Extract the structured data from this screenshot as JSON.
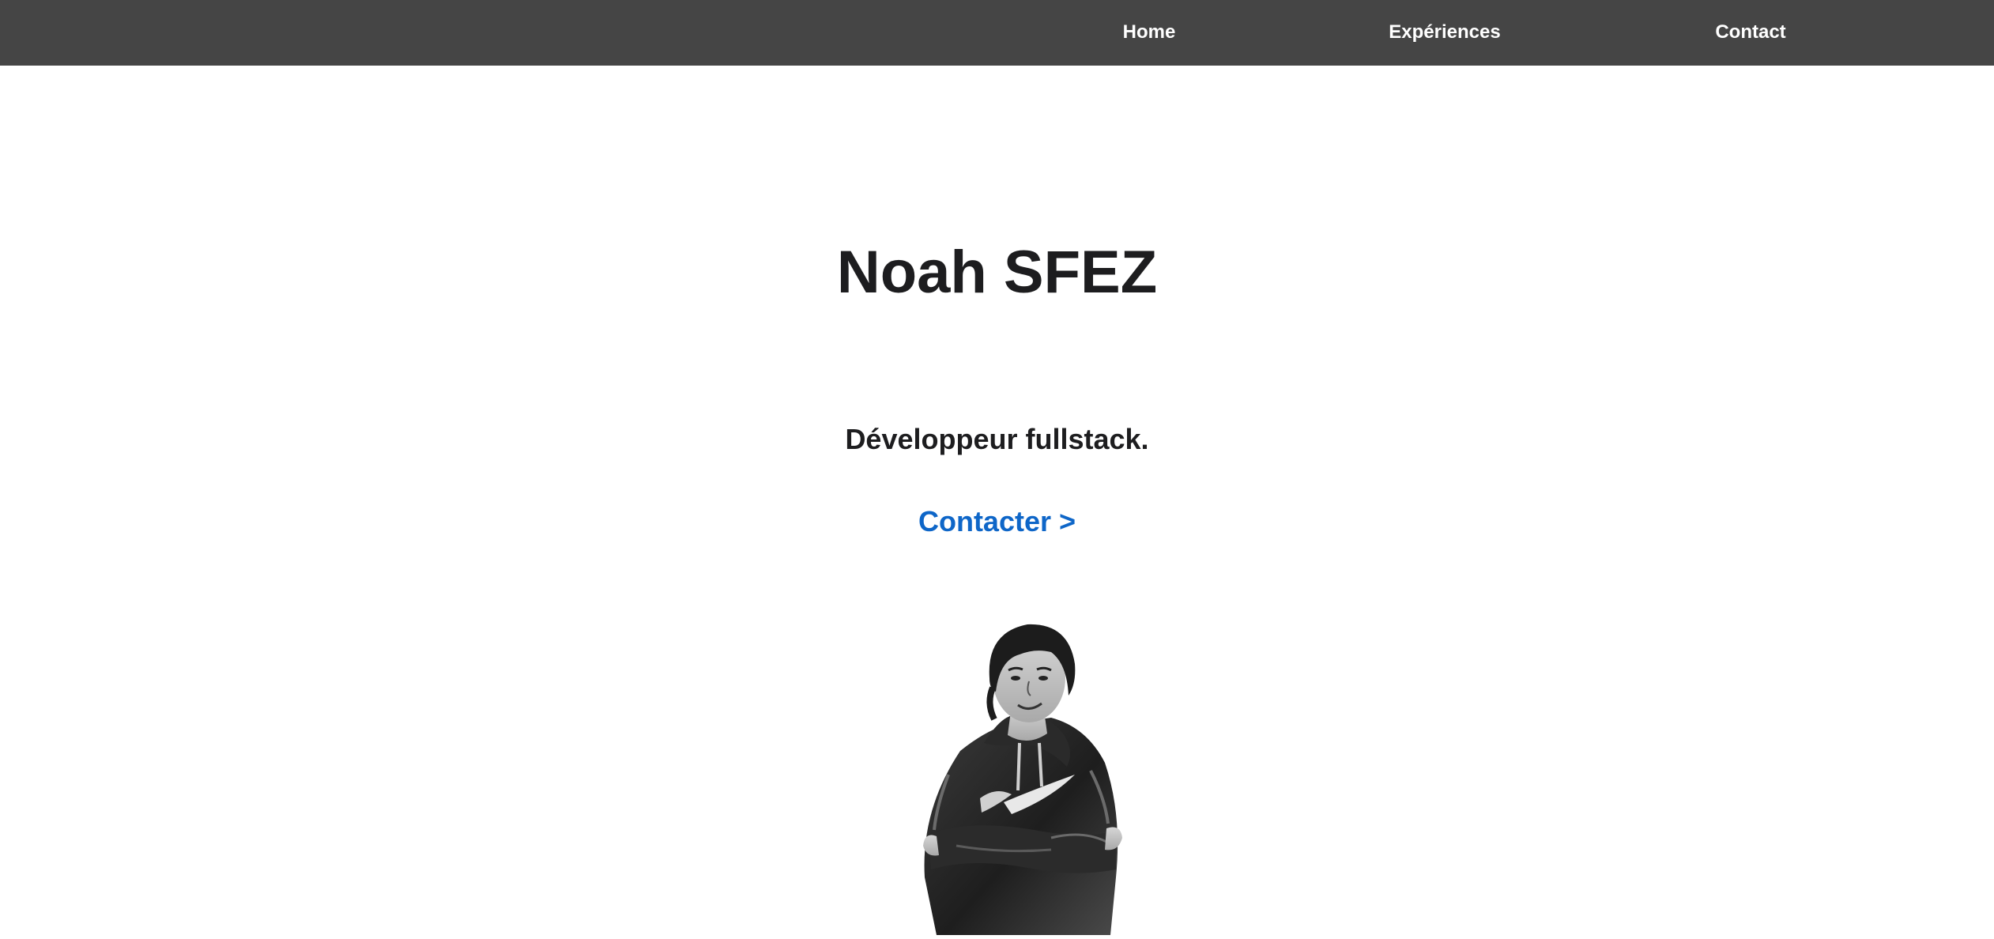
{
  "nav": {
    "items": [
      {
        "label": "Home"
      },
      {
        "label": "Expériences"
      },
      {
        "label": "Contact"
      }
    ]
  },
  "hero": {
    "title": "Noah SFEZ",
    "subtitle": "Développeur fullstack.",
    "cta_label": "Contacter >",
    "portrait_icon": "portrait-illustration"
  },
  "colors": {
    "nav_bg": "#454545",
    "nav_text": "#ffffff",
    "heading_text": "#1d1d1f",
    "link": "#0e66c8",
    "page_bg": "#ffffff"
  }
}
